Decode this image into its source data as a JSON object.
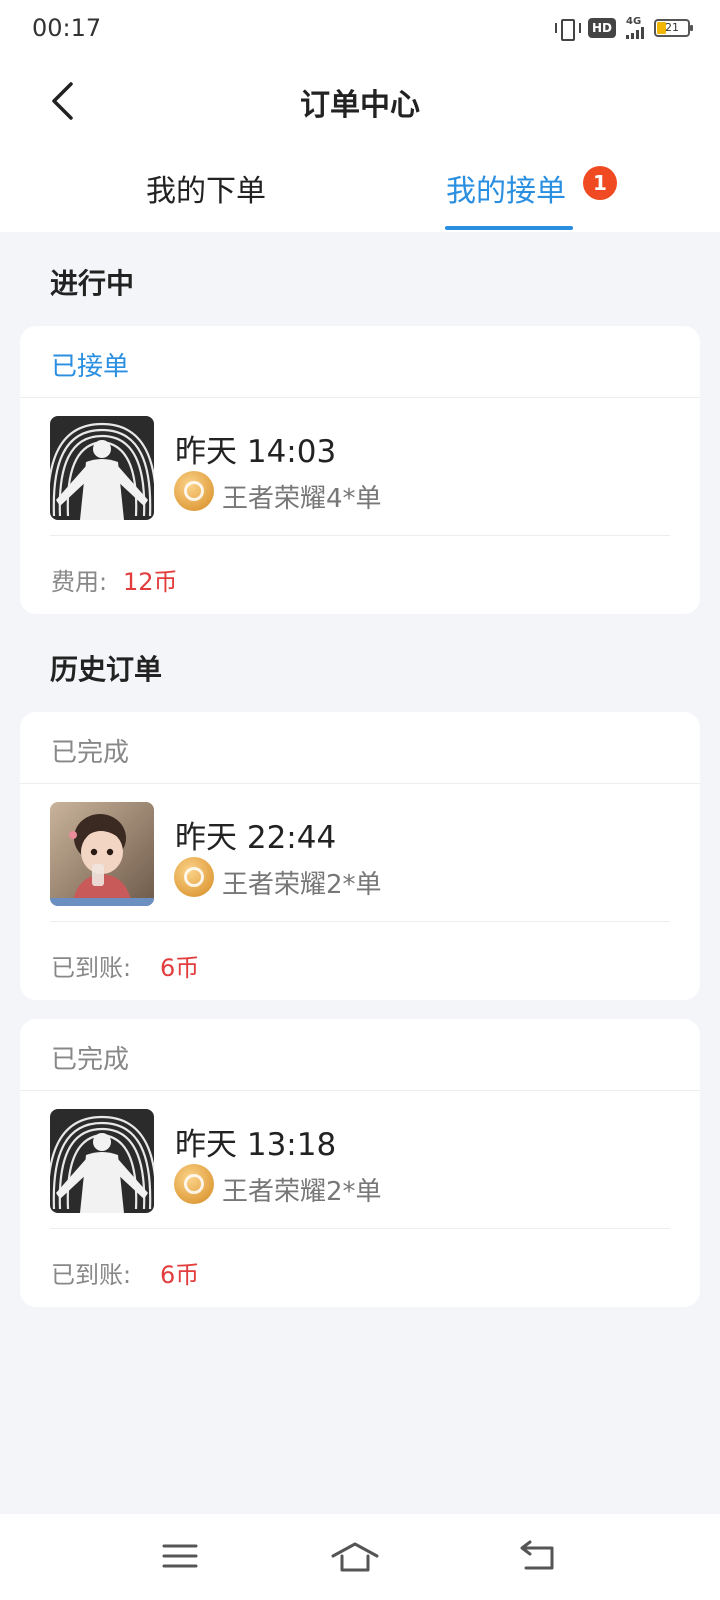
{
  "status_bar": {
    "time": "00:17",
    "hd": "HD",
    "network": "4G",
    "battery": "21"
  },
  "header": {
    "title": "订单中心",
    "back_icon": "chevron-left-icon"
  },
  "tabs": [
    {
      "label": "我的下单",
      "active": false
    },
    {
      "label": "我的接单",
      "active": true,
      "badge": "1"
    }
  ],
  "colors": {
    "accent": "#2a8fe0",
    "badge": "#f04a22",
    "price": "#e23c3c",
    "background": "#f3f5f8"
  },
  "in_progress": {
    "title": "进行中",
    "orders": [
      {
        "status": "已接单",
        "time": "昨天 14:03",
        "game": "王者荣耀4*单",
        "fee_label": "费用:",
        "fee_value": "12币",
        "avatar": "abstract-figure-avatar"
      }
    ]
  },
  "history": {
    "title": "历史订单",
    "orders": [
      {
        "status": "已完成",
        "time": "昨天 22:44",
        "game": "王者荣耀2*单",
        "fee_label": "已到账:",
        "fee_value": "6币",
        "avatar": "child-photo-avatar"
      },
      {
        "status": "已完成",
        "time": "昨天 13:18",
        "game": "王者荣耀2*单",
        "fee_label": "已到账:",
        "fee_value": "6币",
        "avatar": "abstract-figure-avatar"
      }
    ]
  },
  "bottom_nav": {
    "items": [
      "menu-icon",
      "home-icon",
      "back-icon"
    ]
  }
}
